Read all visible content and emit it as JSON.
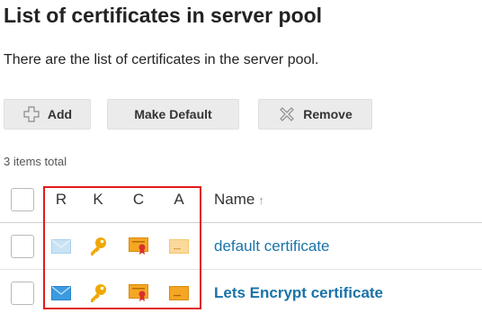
{
  "page": {
    "title": "List of certificates in server pool",
    "description": "There are the list of certificates in the server pool."
  },
  "toolbar": {
    "add_label": "Add",
    "make_default_label": "Make Default",
    "remove_label": "Remove"
  },
  "list": {
    "items_total": "3 items total",
    "columns": {
      "r": "R",
      "k": "K",
      "c": "C",
      "a": "A",
      "name": "Name",
      "sort_indicator": "↑"
    },
    "rows": [
      {
        "name": "default certificate",
        "request_icon": "envelope-icon-faded",
        "key_icon": "key-icon",
        "certificate_icon": "certificate-icon",
        "ca_icon": "ca-certificate-icon-faded"
      },
      {
        "name": "Lets Encrypt certificate",
        "request_icon": "envelope-icon",
        "key_icon": "key-icon",
        "certificate_icon": "certificate-icon",
        "ca_icon": "ca-certificate-icon"
      }
    ]
  },
  "colors": {
    "link": "#1a73a8",
    "highlight": "#e11b1b",
    "key": "#f0a800",
    "envelope": "#3b9be0",
    "certificate": "#f5a623"
  }
}
